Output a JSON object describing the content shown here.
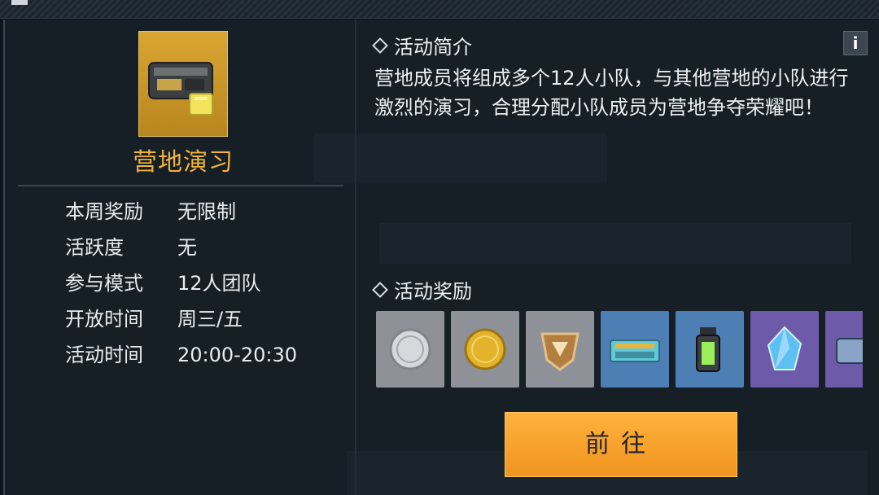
{
  "activity": {
    "name": "营地演习",
    "info": [
      {
        "label": "本周奖励",
        "value": "无限制"
      },
      {
        "label": "活跃度",
        "value": "无"
      },
      {
        "label": "参与模式",
        "value": "12人团队"
      },
      {
        "label": "开放时间",
        "value": "周三/五"
      },
      {
        "label": "活动时间",
        "value": "20:00-20:30"
      }
    ]
  },
  "intro": {
    "title": "活动简介",
    "info_button": "i",
    "text": "营地成员将组成多个12人小队，与其他营地的小队进行激烈的演习，合理分配小队成员为营地争夺荣耀吧！"
  },
  "rewards": {
    "title": "活动奖励",
    "items": [
      {
        "icon": "silver-coin-icon",
        "bg": "#8e9298"
      },
      {
        "icon": "gold-coin-icon",
        "bg": "#8e9298"
      },
      {
        "icon": "badge-icon",
        "bg": "#8e9298"
      },
      {
        "icon": "crate-icon",
        "bg": "#4e7fb4"
      },
      {
        "icon": "grenade-icon",
        "bg": "#4e7fb4"
      },
      {
        "icon": "crystal-icon",
        "bg": "#6d5aa8"
      },
      {
        "icon": "case-icon",
        "bg": "#6d5aa8"
      }
    ]
  },
  "go_button": "前往",
  "colors": {
    "accent": "#f0b43b",
    "button": "#f5a02c"
  }
}
